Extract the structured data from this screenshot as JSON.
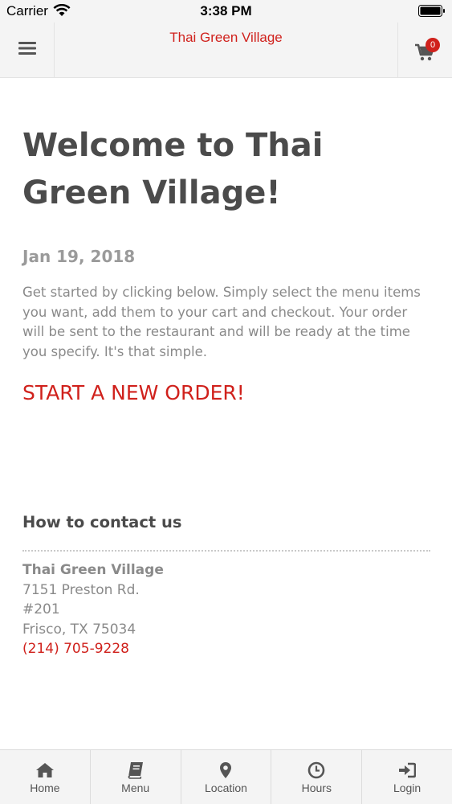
{
  "status_bar": {
    "carrier": "Carrier",
    "time": "3:38 PM"
  },
  "header": {
    "title": "Thai Green Village",
    "cart_count": "0",
    "menu_icon": "hamburger-icon",
    "cart_icon": "cart-icon"
  },
  "main": {
    "title": "Welcome to Thai Green Village!",
    "date": "Jan 19, 2018",
    "intro": "Get started by clicking below. Simply select the menu items you want, add them to your cart and checkout. Your order will be sent to the restaurant and will be ready at the time you specify. It's that simple.",
    "cta_label": "START A NEW ORDER!"
  },
  "contact": {
    "heading": "How to contact us",
    "name": "Thai Green Village",
    "address_line1": "7151 Preston Rd.",
    "address_line2": "#201",
    "city_state_zip": "Frisco, TX 75034",
    "phone": "(214) 705-9228"
  },
  "tabs": [
    {
      "label": "Home",
      "icon": "home-icon"
    },
    {
      "label": "Menu",
      "icon": "book-icon"
    },
    {
      "label": "Location",
      "icon": "map-pin-icon"
    },
    {
      "label": "Hours",
      "icon": "clock-icon"
    },
    {
      "label": "Login",
      "icon": "sign-in-icon"
    }
  ],
  "colors": {
    "accent": "#d0211c",
    "heading": "#4b4b4b",
    "body_text": "#8a8a8a",
    "bar_bg": "#f4f4f4"
  }
}
